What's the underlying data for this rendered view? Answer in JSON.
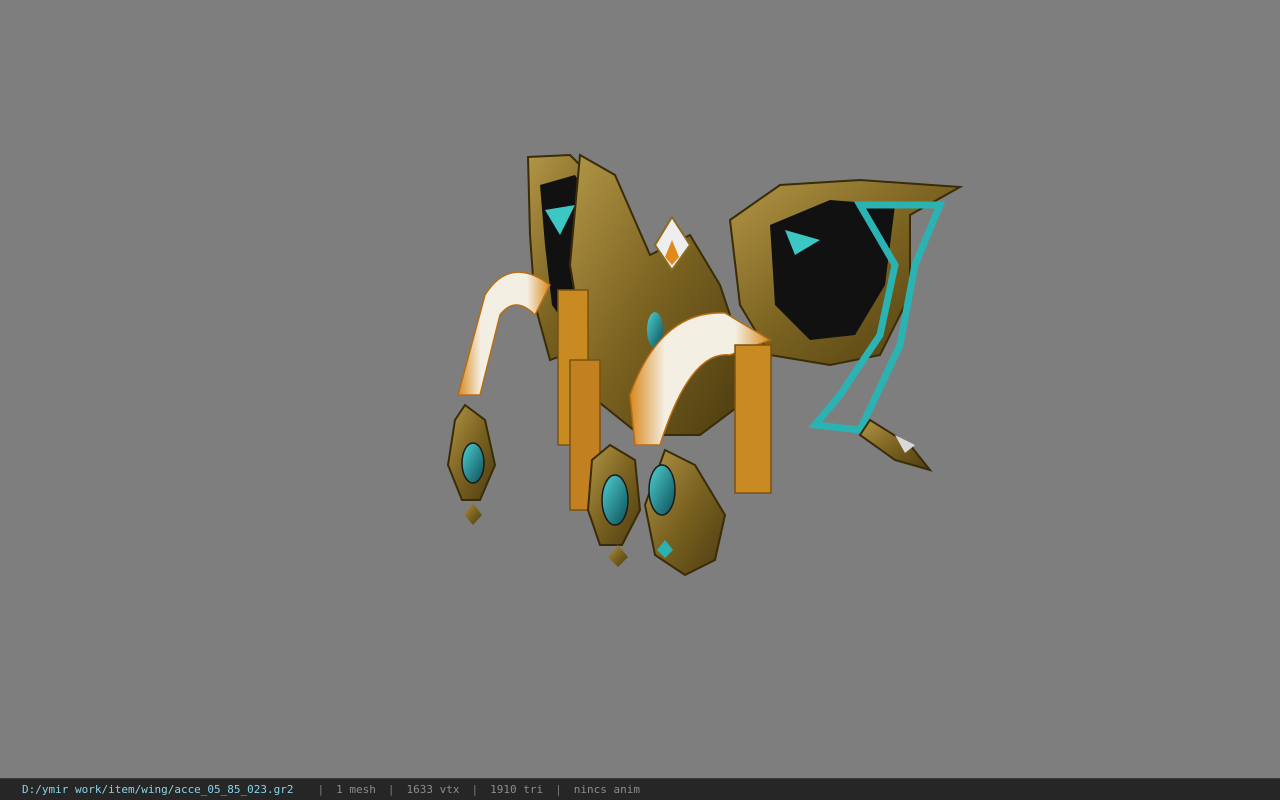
{
  "viewer": {
    "background_color": "#7e7e7e",
    "model_name": "acce_05_85_023"
  },
  "statusbar": {
    "file_path": "D:/ymir work/item/wing/acce_05_85_023.gr2",
    "separator": "|",
    "mesh_count": "1 mesh",
    "vertex_count": "1633 vtx",
    "triangle_count": "1910 tri",
    "anim_status": "nincs anim",
    "path_color": "#8ad2e6",
    "text_color": "#8c8c8c"
  }
}
